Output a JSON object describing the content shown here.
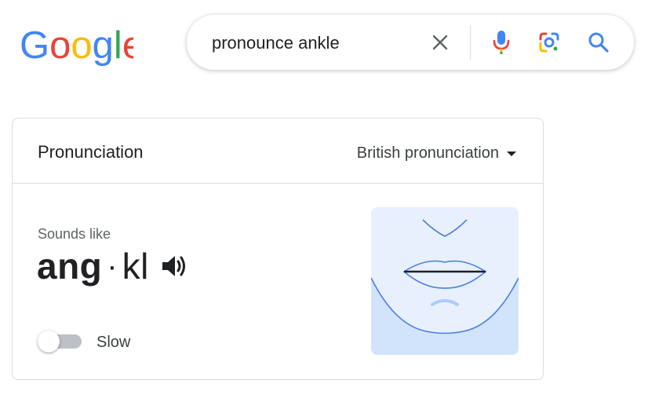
{
  "logo": {
    "text": "Google"
  },
  "search": {
    "query": "pronounce ankle"
  },
  "colors": {
    "google_blue": "#4285F4",
    "google_red": "#EA4335",
    "google_yellow": "#FBBC05",
    "google_green": "#34A853",
    "face_bg": "#e8f0fe",
    "chin_bg": "#d2e3fc",
    "face_line": "#4a7fe0"
  },
  "icons": {
    "clear": "close-icon",
    "voice": "mic-icon",
    "lens": "lens-icon",
    "search": "search-icon",
    "speaker": "speaker-icon",
    "dialect_caret": "caret-down-icon"
  },
  "card": {
    "title": "Pronunciation",
    "dialect": "British pronunciation",
    "sounds_like_label": "Sounds like",
    "syllable_stressed": "ang",
    "separator": "·",
    "syllable_unstressed": "kl",
    "slow_label": "Slow",
    "slow_enabled": false
  }
}
